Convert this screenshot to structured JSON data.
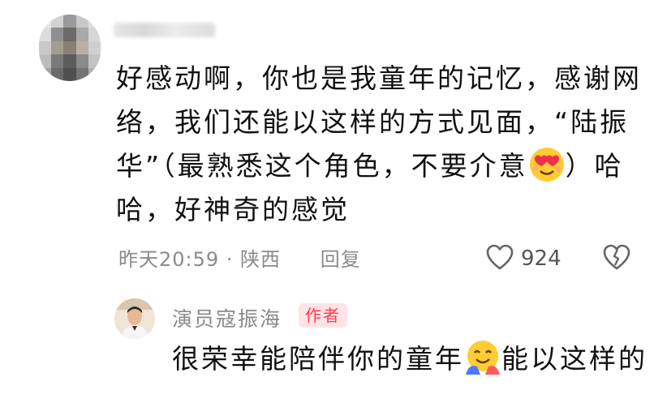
{
  "comment": {
    "lines": [
      "好感动啊，你也是我童年的记忆，感谢网",
      "络，我们还能以这样的方式见面，“陆振",
      "华”（最熟悉这个角色，不要介意",
      "哈，好神奇的感觉"
    ],
    "line3_tail": "）哈",
    "emoji": "heart-eyes-emoji"
  },
  "meta": {
    "time_location": "昨天20:59 · 陕西",
    "reply_label": "回复",
    "like_count": "924"
  },
  "author_reply": {
    "name": "演员寇振海",
    "badge": "作者",
    "text_start": "很荣幸能陪伴你的童年",
    "text_end": "能以这样的",
    "emoji": "hugging-face-emoji"
  },
  "colors": {
    "badge_bg": "#ffe3e6",
    "badge_text": "#ff3b4d",
    "meta_text": "#8a8a8a"
  }
}
